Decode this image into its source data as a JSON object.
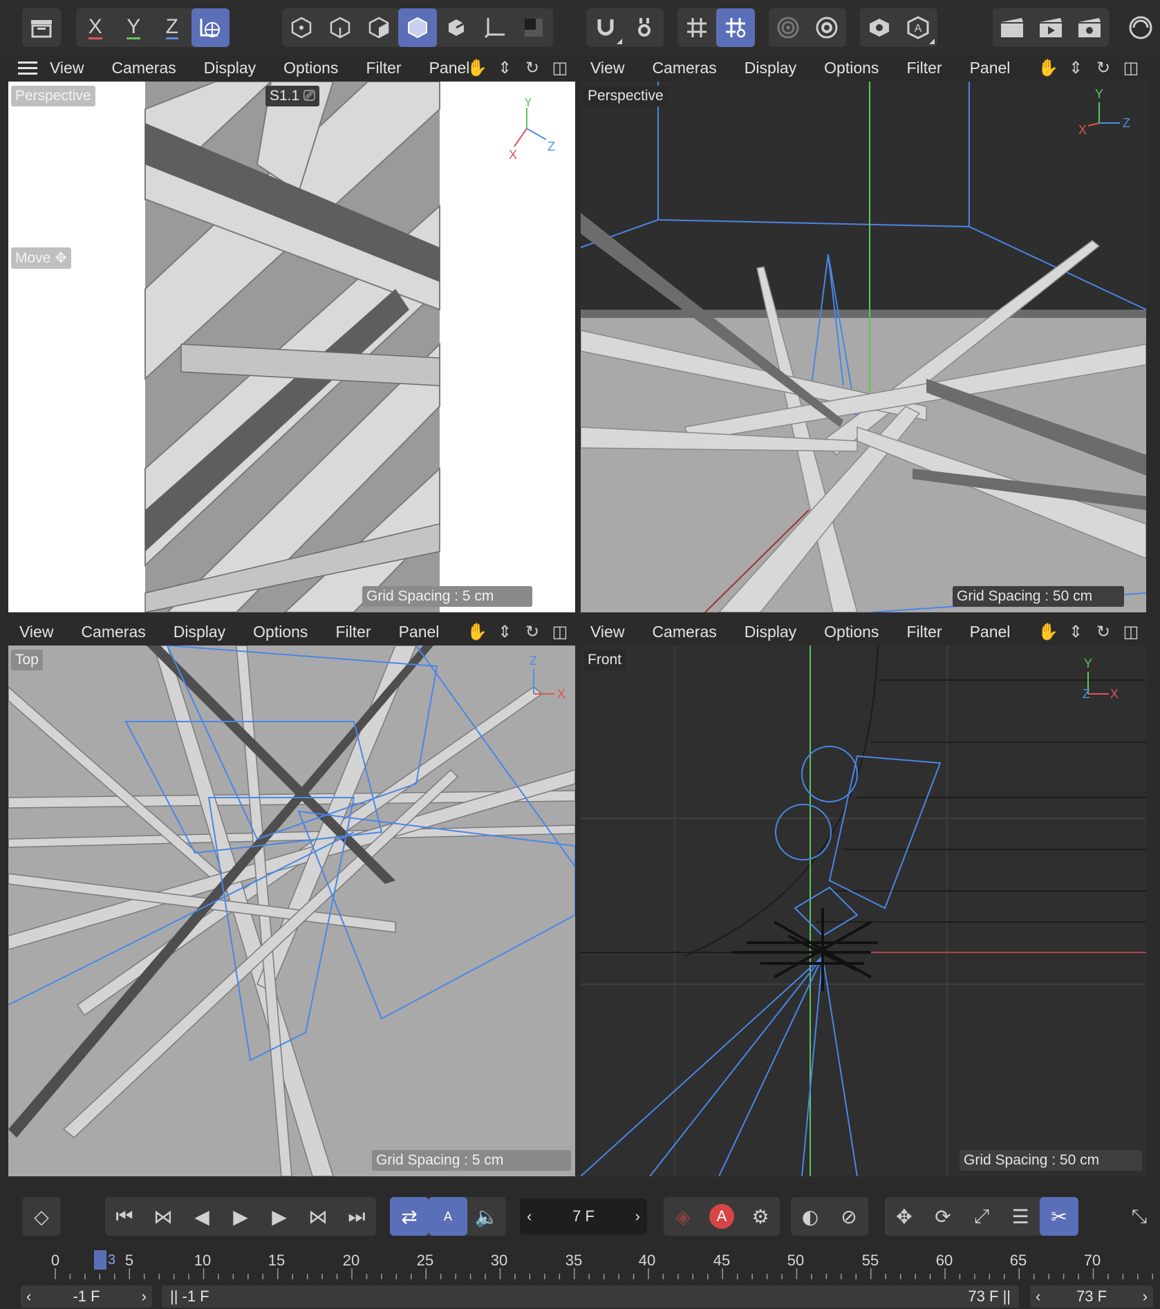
{
  "toolbar": {
    "axis_labels": [
      "X",
      "Y",
      "Z"
    ],
    "icons": [
      "undo-icon",
      "x-axis-icon",
      "y-axis-icon",
      "z-axis-icon",
      "world-coords-icon",
      "points-mode-icon",
      "edges-mode-icon",
      "polygons-mode-icon",
      "model-mode-icon",
      "uv-mode-icon",
      "axis-mode-icon",
      "texture-mode-icon",
      "snap-icon",
      "snap-settings-icon",
      "grid-icon",
      "workplane-icon",
      "solo-icon",
      "solo-settings-icon",
      "view-icon",
      "render-auto-icon",
      "render-view-icon",
      "render-picture-icon",
      "render-settings-icon",
      "cinema-logo-icon"
    ]
  },
  "viewports": [
    {
      "menu": [
        "View",
        "Cameras",
        "Display",
        "Options",
        "Filter",
        "Panel"
      ],
      "label": "Perspective",
      "camera_tag": "S1.1",
      "tool_tag": "Move",
      "grid": "Grid Spacing : 5 cm",
      "axes": {
        "x": "X",
        "y": "Y",
        "z": "Z"
      }
    },
    {
      "menu": [
        "View",
        "Cameras",
        "Display",
        "Options",
        "Filter",
        "Panel"
      ],
      "label": "Perspective",
      "grid": "Grid Spacing : 50 cm",
      "axes": {
        "x": "X",
        "y": "Y",
        "z": "Z"
      }
    },
    {
      "menu": [
        "View",
        "Cameras",
        "Display",
        "Options",
        "Filter",
        "Panel"
      ],
      "label": "Top",
      "grid": "Grid Spacing : 5 cm",
      "axes": {
        "x": "X",
        "y": "Z"
      }
    },
    {
      "menu": [
        "View",
        "Cameras",
        "Display",
        "Options",
        "Filter",
        "Panel"
      ],
      "label": "Front",
      "grid": "Grid Spacing : 50 cm",
      "axes": {
        "x": "X",
        "y": "Y",
        "z": "Z"
      }
    }
  ],
  "timeline": {
    "current_frame": "7 F",
    "playhead_frame": "3",
    "ruler": [
      "0",
      "5",
      "10",
      "15",
      "20",
      "25",
      "30",
      "35",
      "40",
      "45",
      "50",
      "55",
      "60",
      "65",
      "70"
    ],
    "range_start": "-1 F",
    "range_left": "-1 F",
    "range_right": "73 F",
    "range_end": "73 F"
  },
  "colors": {
    "accent": "#5b6fb8",
    "x_axis": "#e05555",
    "y_axis": "#5cc85c",
    "z_axis": "#4f8fe0",
    "wire": "#4a86e8"
  }
}
